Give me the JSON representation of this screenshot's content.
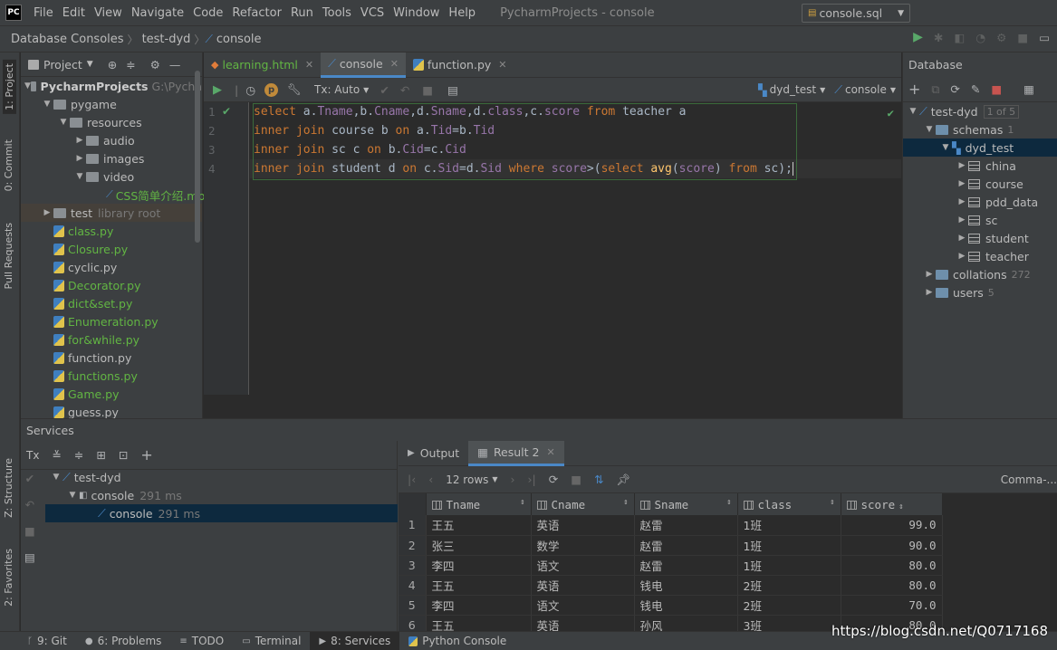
{
  "app": {
    "logo": "PC",
    "title": "PycharmProjects - console"
  },
  "menu": [
    "File",
    "Edit",
    "View",
    "Navigate",
    "Code",
    "Refactor",
    "Run",
    "Tools",
    "VCS",
    "Window",
    "Help"
  ],
  "breadcrumb": [
    "Database Consoles",
    "test-dyd",
    "console"
  ],
  "run_config": "console.sql",
  "left_stripe": {
    "project": "1: Project",
    "commit": "0: Commit",
    "pull": "Pull Requests",
    "structure": "Z: Structure",
    "favorites": "2: Favorites"
  },
  "project": {
    "header": "Project",
    "root": {
      "name": "PycharmProjects",
      "path": "G:\\Pycha"
    },
    "items": [
      {
        "label": "pygame",
        "type": "folder",
        "depth": 1,
        "open": true
      },
      {
        "label": "resources",
        "type": "folder",
        "depth": 2,
        "open": true
      },
      {
        "label": "audio",
        "type": "folder",
        "depth": 3,
        "open": false
      },
      {
        "label": "images",
        "type": "folder",
        "depth": 3,
        "open": false
      },
      {
        "label": "video",
        "type": "folder",
        "depth": 3,
        "open": true
      },
      {
        "label": "CSS简单介绍.mp",
        "type": "media",
        "depth": 5,
        "open": false
      },
      {
        "label": "test",
        "type": "folder",
        "depth": 1,
        "open": false,
        "extra": "library root"
      },
      {
        "label": "class.py",
        "type": "py",
        "depth": 1,
        "color": "green"
      },
      {
        "label": "Closure.py",
        "type": "py",
        "depth": 1,
        "color": "green"
      },
      {
        "label": "cyclic.py",
        "type": "py",
        "depth": 1,
        "color": "normal"
      },
      {
        "label": "Decorator.py",
        "type": "py",
        "depth": 1,
        "color": "green"
      },
      {
        "label": "dict&set.py",
        "type": "py",
        "depth": 1,
        "color": "green"
      },
      {
        "label": "Enumeration.py",
        "type": "py",
        "depth": 1,
        "color": "green"
      },
      {
        "label": "for&while.py",
        "type": "py",
        "depth": 1,
        "color": "green"
      },
      {
        "label": "function.py",
        "type": "py",
        "depth": 1,
        "color": "normal"
      },
      {
        "label": "functions.py",
        "type": "py",
        "depth": 1,
        "color": "green"
      },
      {
        "label": "Game.py",
        "type": "py",
        "depth": 1,
        "color": "green"
      },
      {
        "label": "guess.py",
        "type": "py",
        "depth": 1,
        "color": "normal"
      }
    ]
  },
  "editor_tabs": [
    {
      "label": "learning.html",
      "active": false
    },
    {
      "label": "console",
      "active": true
    },
    {
      "label": "function.py",
      "active": false
    }
  ],
  "editor_toolbar": {
    "tx": "Tx: Auto",
    "schema": "dyd_test",
    "console": "console"
  },
  "code_lines": [
    "1",
    "2",
    "3",
    "4"
  ],
  "code": {
    "l1": {
      "a": "select ",
      "b": "a",
      "c": ".",
      "d": "Tname",
      "e": ",b.",
      "f": "Cname",
      "g": ",d.",
      "h": "Sname",
      "i": ",d.",
      "j": "class",
      "k": ",c.",
      "l": "score",
      "m": " from ",
      "n": "teacher a"
    },
    "l2": {
      "a": "inner join ",
      "b": "course b ",
      "c": "on ",
      "d": "a.",
      "e": "Tid",
      "f": "=b.",
      "g": "Tid"
    },
    "l3": {
      "a": "inner join ",
      "b": "sc c ",
      "c": "on ",
      "d": "b.",
      "e": "Cid",
      "f": "=c.",
      "g": "Cid"
    },
    "l4": {
      "a": "inner join ",
      "b": "student d ",
      "c": "on ",
      "d": "c.",
      "e": "Sid",
      "f": "=d.",
      "g": "Sid",
      "h": " where ",
      "i": "score",
      "j": ">(",
      "k": "select ",
      "l": "avg",
      "m": "(",
      "n": "score",
      "o": ") ",
      "p": "from ",
      "q": "sc);"
    }
  },
  "database": {
    "header": "Database",
    "source": {
      "label": "test-dyd",
      "badge": "1 of 5"
    },
    "schemas": {
      "label": "schemas",
      "count": "1"
    },
    "schema": "dyd_test",
    "tables": [
      "china",
      "course",
      "pdd_data",
      "sc",
      "student",
      "teacher"
    ],
    "collations": {
      "label": "collations",
      "count": "272"
    },
    "users": {
      "label": "users",
      "count": "5"
    }
  },
  "services": {
    "header": "Services",
    "tx": "Tx",
    "tree": [
      {
        "label": "test-dyd",
        "time": ""
      },
      {
        "label": "console",
        "time": "291 ms"
      },
      {
        "label": "console",
        "time": "291 ms"
      }
    ]
  },
  "result": {
    "tabs": [
      "Output",
      "Result 2"
    ],
    "rows_label": "12 rows",
    "export": "Comma-...",
    "columns": [
      "Tname",
      "Cname",
      "Sname",
      "class",
      "score"
    ],
    "rows": [
      [
        "1",
        "王五",
        "英语",
        "赵雷",
        "1班",
        "99.0"
      ],
      [
        "2",
        "张三",
        "数学",
        "赵雷",
        "1班",
        "90.0"
      ],
      [
        "3",
        "李四",
        "语文",
        "赵雷",
        "1班",
        "80.0"
      ],
      [
        "4",
        "王五",
        "英语",
        "钱电",
        "2班",
        "80.0"
      ],
      [
        "5",
        "李四",
        "语文",
        "钱电",
        "2班",
        "70.0"
      ],
      [
        "6",
        "王五",
        "英语",
        "孙风",
        "3班",
        "80.0"
      ]
    ]
  },
  "status": [
    {
      "label": "9: Git",
      "active": false
    },
    {
      "label": "6: Problems",
      "active": false
    },
    {
      "label": "TODO",
      "active": false
    },
    {
      "label": "Terminal",
      "active": false
    },
    {
      "label": "8: Services",
      "active": true
    },
    {
      "label": "Python Console",
      "active": false
    }
  ],
  "watermark": "https://blog.csdn.net/Q0717168"
}
